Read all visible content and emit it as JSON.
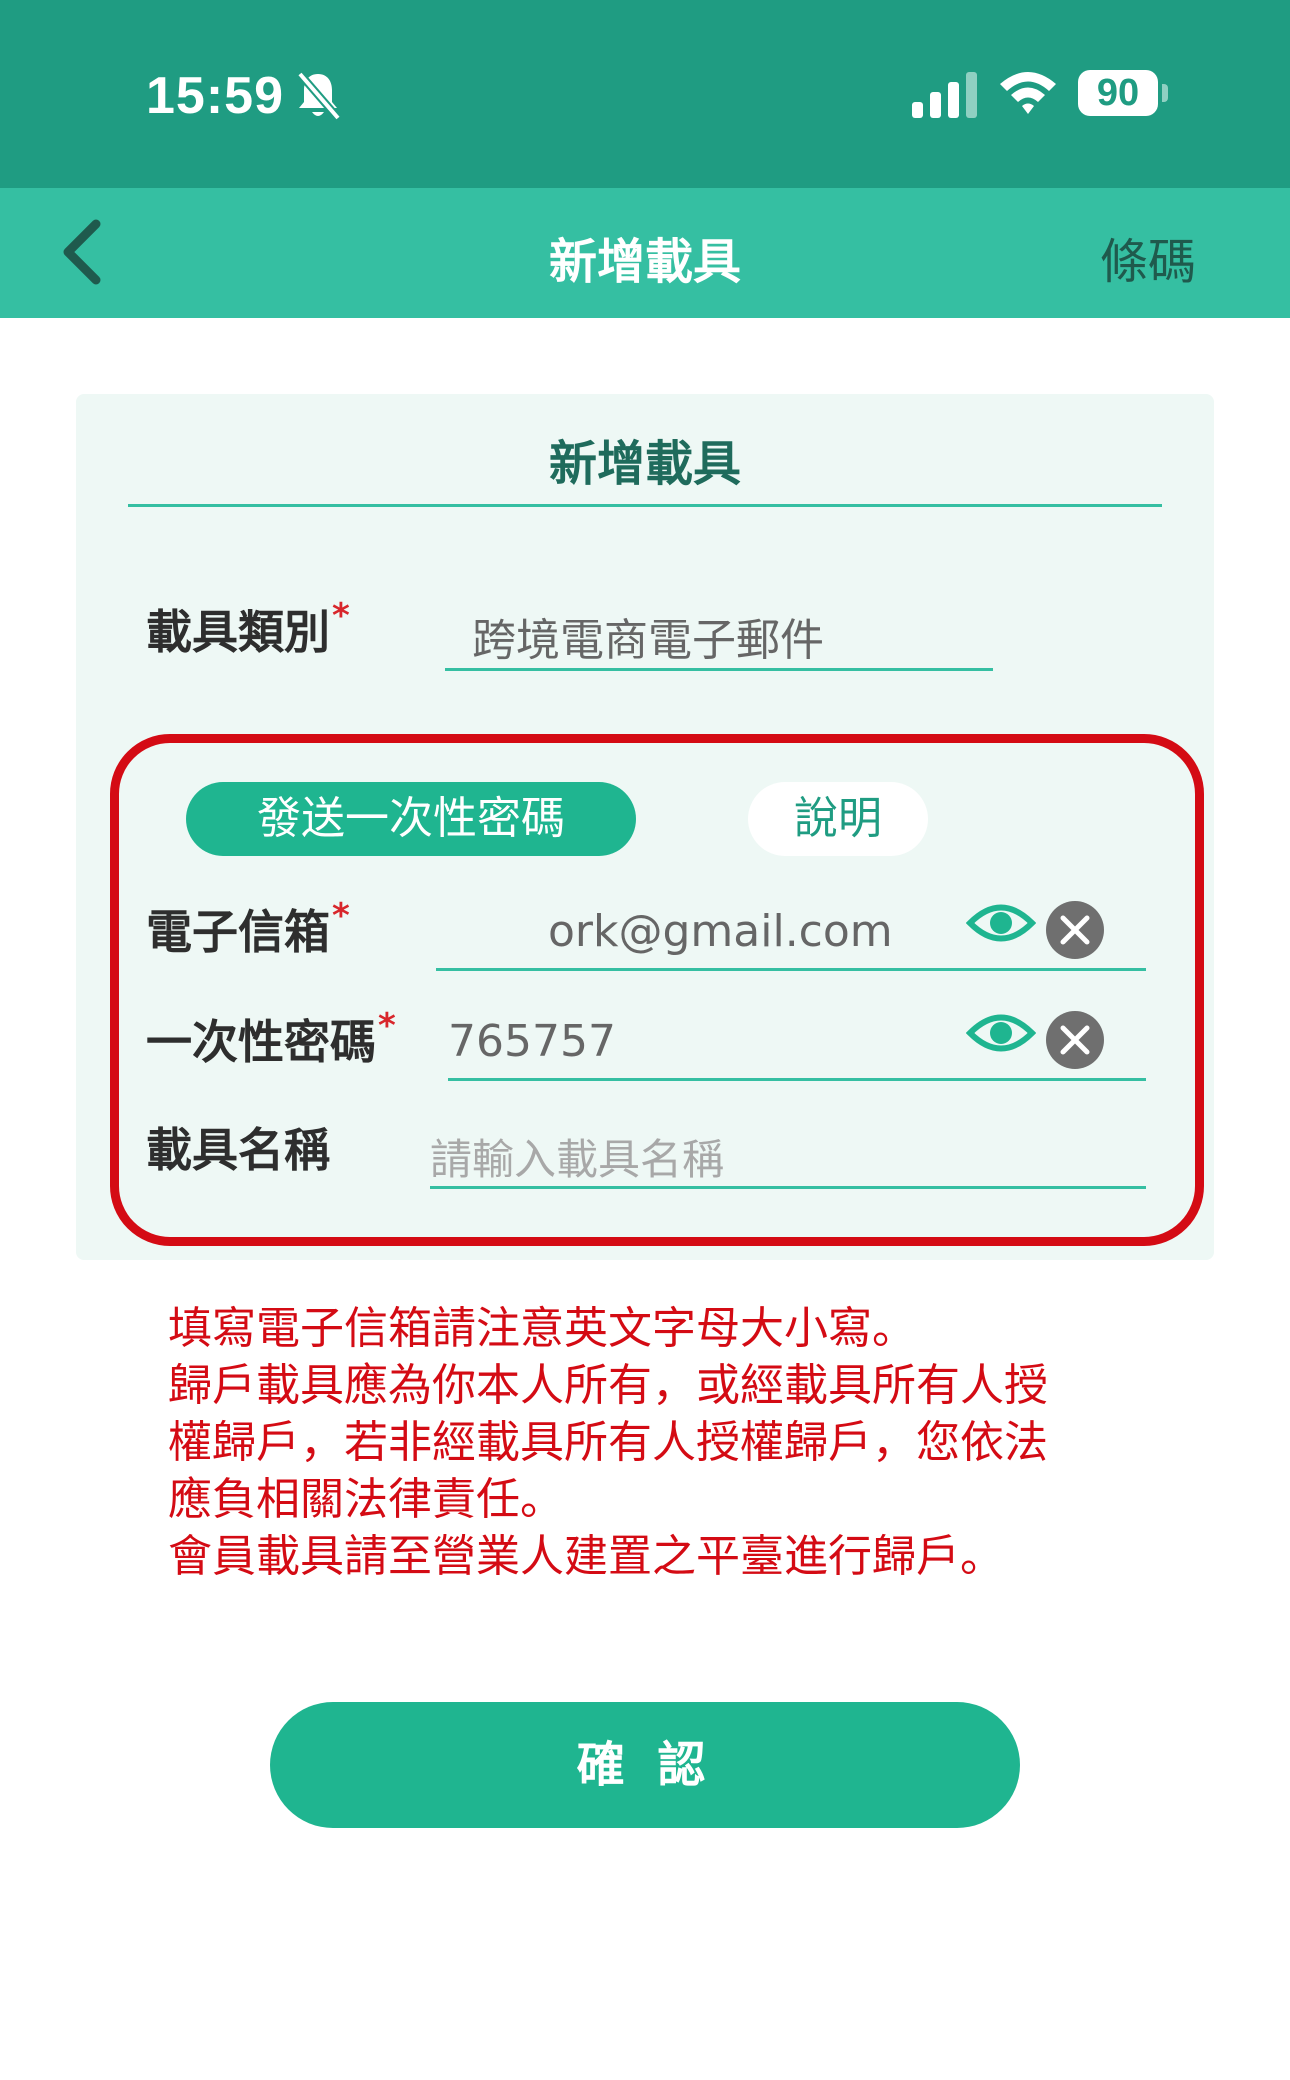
{
  "status_bar": {
    "time": "15:59",
    "battery": "90",
    "icons": [
      "bell-slash-icon",
      "cellular-signal-icon",
      "wifi-icon",
      "battery-icon"
    ]
  },
  "nav": {
    "title": "新增載具",
    "right_label": "條碼",
    "back_icon": "chevron-left-icon"
  },
  "card": {
    "title": "新增載具",
    "carrier_type": {
      "label": "載具類別",
      "required_mark": "*",
      "value": "跨境電商電子郵件"
    },
    "otp_button": "發送一次性密碼",
    "help_button": "說明",
    "email": {
      "label": "電子信箱",
      "required_mark": "*",
      "value": "ork@gmail.com"
    },
    "otp": {
      "label": "一次性密碼",
      "required_mark": "*",
      "value": "765757"
    },
    "carrier_name": {
      "label": "載具名稱",
      "placeholder": "請輸入載具名稱"
    }
  },
  "notice": [
    "填寫電子信箱請注意英文字母大小寫。",
    "歸戶載具應為你本人所有，或經載具所有人授",
    "權歸戶，若非經載具所有人授權歸戶，您依法",
    "應負相關法律責任。",
    "會員載具請至營業人建置之平臺進行歸戶。"
  ],
  "confirm_button": "確 認",
  "colors": {
    "status_bar": "#1f9c82",
    "nav_bar": "#35bfa2",
    "accent": "#1fb590",
    "highlight": "#d40b14",
    "card_bg": "#eef8f5"
  }
}
